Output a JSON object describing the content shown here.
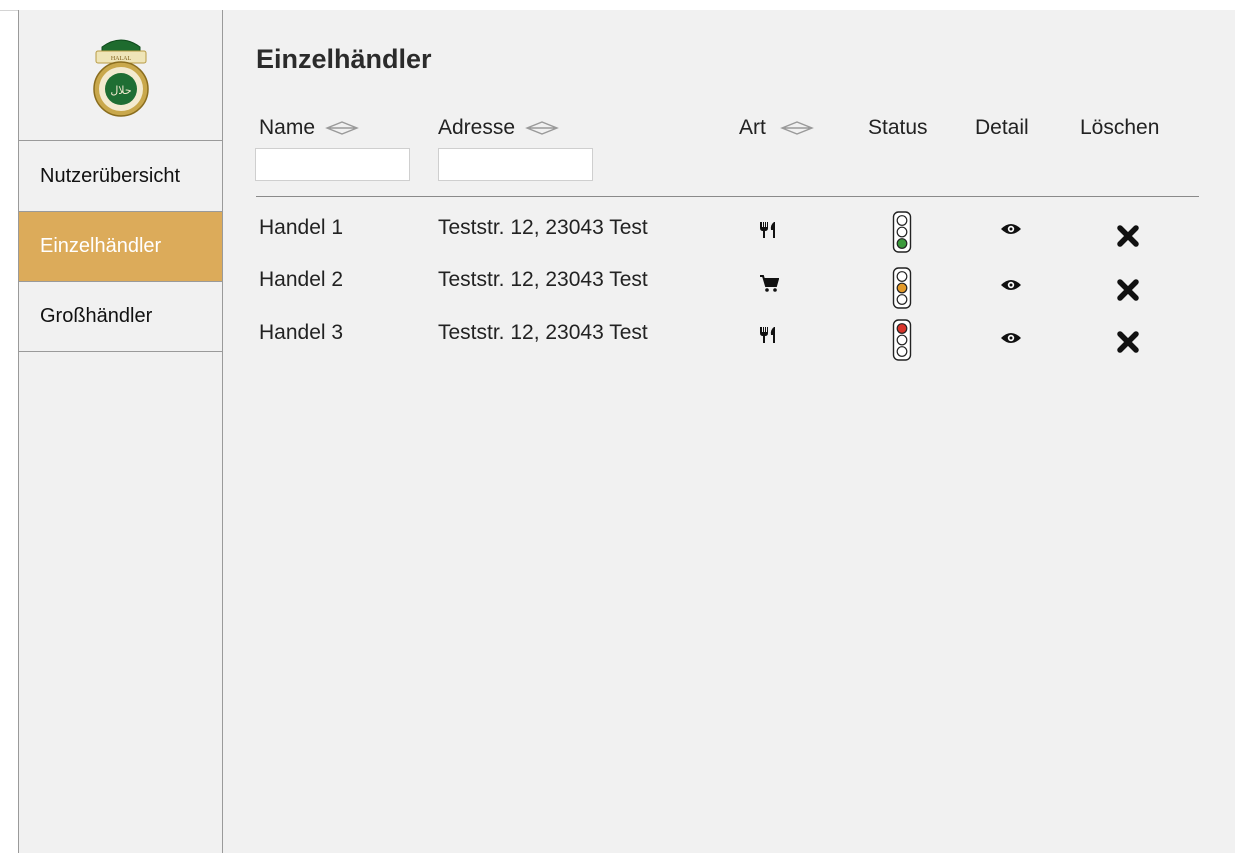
{
  "page": {
    "title": "Einzelhändler"
  },
  "sidebar": {
    "logo": {
      "icon": "halal-certificate-logo",
      "top_banner": "HALAL",
      "center_text": "حلال"
    },
    "items": [
      {
        "label": "Nutzerübersicht",
        "active": false
      },
      {
        "label": "Einzelhändler",
        "active": true
      },
      {
        "label": "Großhändler",
        "active": false
      }
    ],
    "active_color": "#dcab5a"
  },
  "table": {
    "columns": [
      {
        "label": "Name",
        "sortable": true,
        "filter": true
      },
      {
        "label": "Adresse",
        "sortable": true,
        "filter": true
      },
      {
        "label": "Art",
        "sortable": true,
        "filter": false
      },
      {
        "label": "Status",
        "sortable": false,
        "filter": false
      },
      {
        "label": "Detail",
        "sortable": false,
        "filter": false
      },
      {
        "label": "Löschen",
        "sortable": false,
        "filter": false
      }
    ],
    "filters": {
      "name_value": "",
      "address_value": ""
    },
    "rows": [
      {
        "name": "Handel 1",
        "address": "Teststr. 12, 23043 Test",
        "type_icon": "restaurant-icon",
        "status": "green",
        "detail_icon": "eye-icon",
        "delete_icon": "delete-x-icon"
      },
      {
        "name": "Handel 2",
        "address": "Teststr. 12, 23043 Test",
        "type_icon": "shopping-cart-icon",
        "status": "orange",
        "detail_icon": "eye-icon",
        "delete_icon": "delete-x-icon"
      },
      {
        "name": "Handel 3",
        "address": "Teststr. 12, 23043 Test",
        "type_icon": "restaurant-icon",
        "status": "red",
        "detail_icon": "eye-icon",
        "delete_icon": "delete-x-icon"
      }
    ]
  },
  "status_colors": {
    "green": "#3c9a3c",
    "orange": "#e39a2a",
    "red": "#d8342b"
  }
}
